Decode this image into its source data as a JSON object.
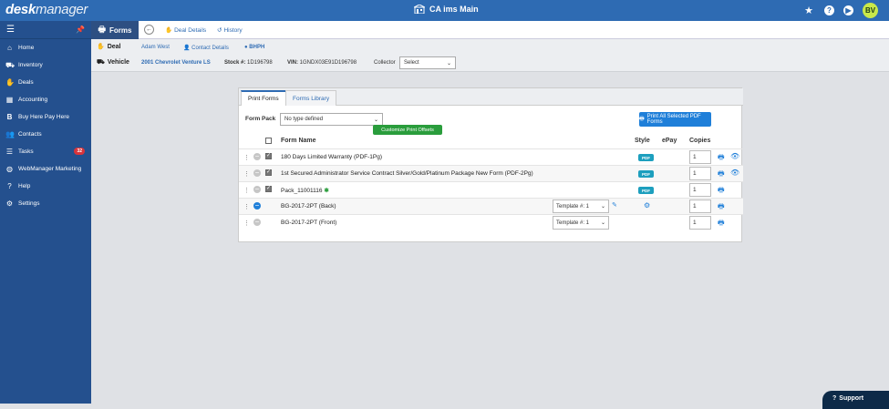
{
  "app": {
    "logo_bold": "desk",
    "logo_light": "manager",
    "store_name": "CA ims Main",
    "user_initials": "BV",
    "icons": {
      "store": "store-icon",
      "star": "star-icon",
      "help": "help-icon",
      "play": "play-icon"
    }
  },
  "sidebar": {
    "menu_icon": "hamburger-icon",
    "pin_icon": "pin-icon",
    "items": [
      {
        "label": "Home",
        "icon": "home-icon"
      },
      {
        "label": "Inventory",
        "icon": "car-icon"
      },
      {
        "label": "Deals",
        "icon": "handshake-icon"
      },
      {
        "label": "Accounting",
        "icon": "accounting-icon"
      },
      {
        "label": "Buy Here Pay Here",
        "icon": "bhph-icon"
      },
      {
        "label": "Contacts",
        "icon": "contacts-icon"
      },
      {
        "label": "Tasks",
        "icon": "tasks-icon",
        "badge": "32"
      },
      {
        "label": "WebManager Marketing",
        "icon": "globe-icon"
      },
      {
        "label": "Help",
        "icon": "help-icon"
      },
      {
        "label": "Settings",
        "icon": "gear-icon"
      }
    ]
  },
  "subnav": {
    "forms_label": "Forms",
    "deal_details": "Deal Details",
    "history": "History"
  },
  "deal": {
    "deal_label": "Deal",
    "customer": "Adam West",
    "contact_details": "Contact Details",
    "type": "BHPH",
    "vehicle_label": "Vehicle",
    "vehicle": "2001 Chevrolet Venture LS",
    "stock_label": "Stock #:",
    "stock": "1D196798",
    "vin_label": "VIN:",
    "vin": "1GNDX03E91D196798",
    "collector_label": "Collector",
    "collector_value": "Select"
  },
  "forms": {
    "tabs": [
      "Print Forms",
      "Forms Library"
    ],
    "form_pack_label": "Form Pack",
    "form_pack_value": "No type defined",
    "print_all_label": "Print All Selected PDF Forms",
    "headers": {
      "name": "Form Name",
      "style": "Style",
      "epay": "ePay",
      "copies": "Copies"
    },
    "rows": [
      {
        "name": "180 Days Limited Warranty (PDF-1Pg)",
        "checked": true,
        "style": "PDF",
        "copies": "1",
        "print": true,
        "preview": true
      },
      {
        "name": "1st Secured Administrator Service Contract Silver/Gold/Platinum Package New Form (PDF-2Pg)",
        "checked": true,
        "style": "PDF",
        "copies": "1",
        "print": true,
        "preview": true
      },
      {
        "name": "Pack_11001116",
        "checked": true,
        "style": "PDF",
        "copies": "1",
        "print": true,
        "preview": false
      },
      {
        "name": "BG-2017-2PT (Back)",
        "checked": false,
        "template": "Template #: 1",
        "copies": "1",
        "print": true
      },
      {
        "name": "BG-2017-2PT (Front)",
        "checked": false,
        "template": "Template #: 1",
        "copies": "1",
        "print": true
      }
    ],
    "tooltip": "Customize Print Offsets"
  },
  "support_label": "Support"
}
